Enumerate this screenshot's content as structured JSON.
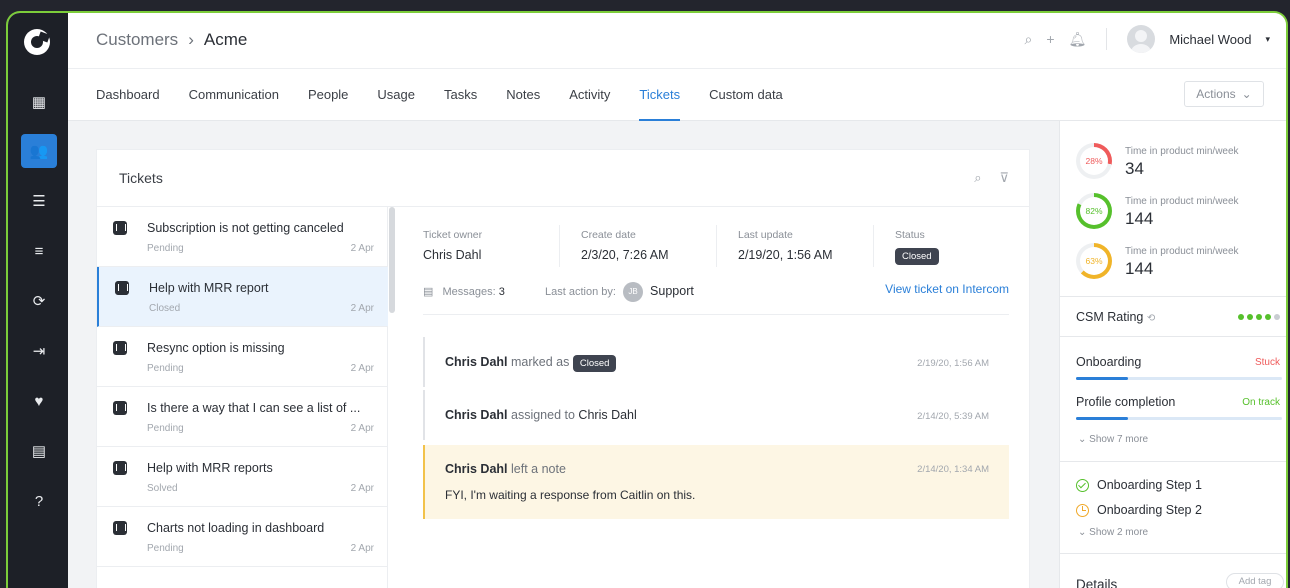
{
  "header": {
    "breadcrumb_parent": "Customers",
    "breadcrumb_current": "Acme",
    "user_name": "Michael Wood"
  },
  "tabs": [
    {
      "label": "Dashboard"
    },
    {
      "label": "Communication"
    },
    {
      "label": "People"
    },
    {
      "label": "Usage"
    },
    {
      "label": "Tasks"
    },
    {
      "label": "Notes"
    },
    {
      "label": "Activity"
    },
    {
      "label": "Tickets",
      "active": true
    },
    {
      "label": "Custom data"
    }
  ],
  "actions_label": "Actions",
  "tickets": {
    "title": "Tickets",
    "items": [
      {
        "title": "Subscription is not getting canceled",
        "status": "Pending",
        "date": "2 Apr"
      },
      {
        "title": "Help with MRR report",
        "status": "Closed",
        "date": "2 Apr"
      },
      {
        "title": "Resync option is missing",
        "status": "Pending",
        "date": "2 Apr"
      },
      {
        "title": "Is there a way that I can see a list of ...",
        "status": "Pending",
        "date": "2 Apr"
      },
      {
        "title": "Help with MRR reports",
        "status": "Solved",
        "date": "2 Apr"
      },
      {
        "title": "Charts not loading in dashboard",
        "status": "Pending",
        "date": "2 Apr"
      }
    ]
  },
  "detail": {
    "owner_label": "Ticket owner",
    "owner": "Chris Dahl",
    "create_label": "Create date",
    "create_date": "2/3/20, 7:26 AM",
    "update_label": "Last update",
    "update_date": "2/19/20, 1:56 AM",
    "status_label": "Status",
    "status": "Closed",
    "messages_label": "Messages:",
    "messages_count": "3",
    "last_action_label": "Last action by:",
    "last_action_initials": "JB",
    "last_action_by": "Support",
    "view_link": "View ticket on Intercom",
    "events": [
      {
        "actor": "Chris Dahl",
        "action": "marked as",
        "badge": "Closed",
        "time": "2/19/20, 1:56 AM"
      },
      {
        "actor": "Chris Dahl",
        "action": "assigned to",
        "target": "Chris Dahl",
        "time": "2/14/20, 5:39 AM"
      },
      {
        "actor": "Chris Dahl",
        "action": "left a note",
        "note": "FYI, I'm waiting a response from  Caitlin on this.",
        "time": "2/14/20, 1:34 AM"
      }
    ]
  },
  "metrics": [
    {
      "pct": "28%",
      "pct_value": 28,
      "label": "Time in product min/week",
      "value": "34",
      "color": "#ef5b5b"
    },
    {
      "pct": "82%",
      "pct_value": 82,
      "label": "Time in product min/week",
      "value": "144",
      "color": "#56c02c"
    },
    {
      "pct": "63%",
      "pct_value": 63,
      "label": "Time in product min/week",
      "value": "144",
      "color": "#f0b429"
    }
  ],
  "csm": {
    "label": "CSM Rating",
    "rating": 4,
    "max": 5
  },
  "health": {
    "items": [
      {
        "label": "Onboarding",
        "status": "Stuck",
        "status_color": "#ef5b5b",
        "progress": 0.25
      },
      {
        "label": "Profile completion",
        "status": "On track",
        "status_color": "#56c02c",
        "progress": 0.25
      }
    ],
    "more": "Show 7 more"
  },
  "steps": {
    "items": [
      {
        "label": "Onboarding Step 1",
        "state": "done"
      },
      {
        "label": "Onboarding Step 2",
        "state": "pending"
      }
    ],
    "more": "Show 2 more"
  },
  "details": {
    "label": "Details",
    "add_tag": "Add tag"
  }
}
